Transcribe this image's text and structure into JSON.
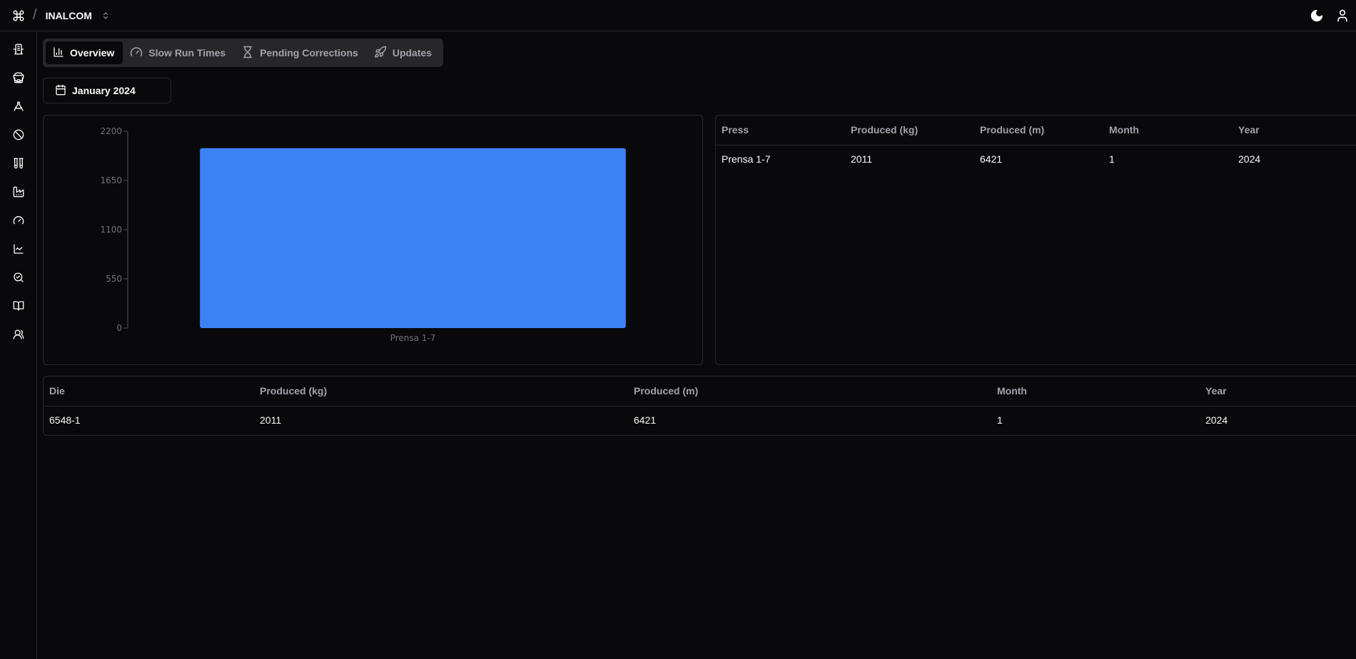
{
  "header": {
    "org_name": "INALCOM",
    "logo_icon": "command-icon",
    "switch_icon": "chevrons-up-down-icon",
    "theme_icon": "moon-icon",
    "user_icon": "user-icon"
  },
  "sidebar": {
    "items": [
      {
        "icon": "building-icon"
      },
      {
        "icon": "store-icon"
      },
      {
        "icon": "drafting-compass-icon"
      },
      {
        "icon": "ban-icon"
      },
      {
        "icon": "test-tubes-icon"
      },
      {
        "icon": "factory-icon"
      },
      {
        "icon": "gauge-icon"
      },
      {
        "icon": "line-chart-icon"
      },
      {
        "icon": "zoom-check-icon"
      },
      {
        "icon": "book-open-icon"
      },
      {
        "icon": "users-icon"
      }
    ]
  },
  "tabs": [
    {
      "label": "Overview",
      "icon": "bar-chart-icon",
      "active": true
    },
    {
      "label": "Slow Run Times",
      "icon": "gauge-icon",
      "active": false
    },
    {
      "label": "Pending Corrections",
      "icon": "hourglass-icon",
      "active": false
    },
    {
      "label": "Updates",
      "icon": "rocket-icon",
      "active": false
    }
  ],
  "date_picker": {
    "label": "January 2024",
    "icon": "calendar-icon"
  },
  "colors": {
    "accent_bar": "#3b82f6",
    "background": "#09090b",
    "border": "#27272a",
    "muted_text": "#a1a1aa"
  },
  "chart_data": {
    "type": "bar",
    "categories": [
      "Prensa 1-7"
    ],
    "values": [
      2011
    ],
    "title": "",
    "xlabel": "",
    "ylabel": "",
    "ylim": [
      0,
      2200
    ],
    "yticks": [
      0,
      550,
      1100,
      1650,
      2200
    ],
    "grid": false,
    "color": "#3b82f6"
  },
  "press_table": {
    "columns": [
      "Press",
      "Produced (kg)",
      "Produced (m)",
      "Month",
      "Year"
    ],
    "rows": [
      [
        "Prensa 1-7",
        "2011",
        "6421",
        "1",
        "2024"
      ]
    ]
  },
  "die_table": {
    "columns": [
      "Die",
      "Produced (kg)",
      "Produced (m)",
      "Month",
      "Year"
    ],
    "rows": [
      [
        "6548-1",
        "2011",
        "6421",
        "1",
        "2024"
      ]
    ]
  }
}
